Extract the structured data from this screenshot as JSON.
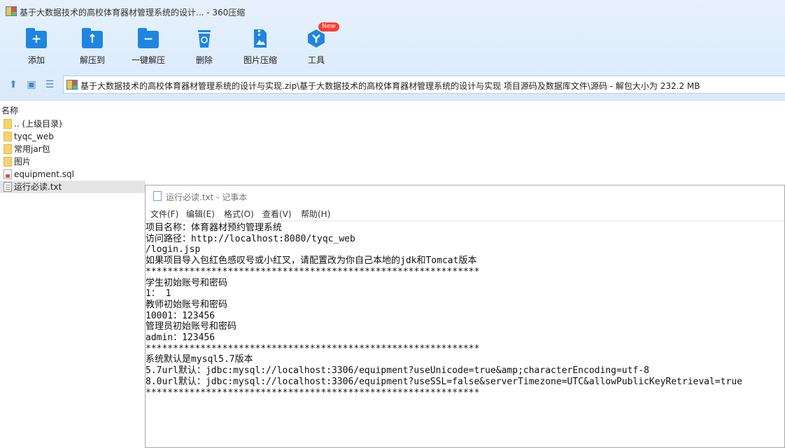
{
  "window": {
    "title": "基于大数据技术的高校体育器材管理系统的设计... - 360压缩"
  },
  "toolbar": {
    "items": [
      {
        "label": "添加",
        "icon": "add-icon"
      },
      {
        "label": "解压到",
        "icon": "extract-to-icon"
      },
      {
        "label": "一键解压",
        "icon": "one-click-extract-icon"
      },
      {
        "label": "删除",
        "icon": "delete-icon"
      },
      {
        "label": "图片压缩",
        "icon": "image-compress-icon"
      },
      {
        "label": "工具",
        "icon": "tools-icon",
        "badge": "New"
      }
    ]
  },
  "path": {
    "text": "基于大数据技术的高校体育器材管理系统的设计与实现.zip\\基于大数据技术的高校体育器材管理系统的设计与实现 项目源码及数据库文件\\源码 - 解包大小为 232.2 MB"
  },
  "filelist": {
    "header": "名称",
    "items": [
      {
        "name": ".. (上级目录)",
        "type": "folder"
      },
      {
        "name": "tyqc_web",
        "type": "folder"
      },
      {
        "name": "常用jar包",
        "type": "folder"
      },
      {
        "name": "图片",
        "type": "folder"
      },
      {
        "name": "equipment.sql",
        "type": "sql"
      },
      {
        "name": "运行必读.txt",
        "type": "txt",
        "selected": true
      }
    ]
  },
  "notepad": {
    "title": "运行必读.txt - 记事本",
    "menu": [
      "文件(F)",
      "编辑(E)",
      "格式(O)",
      "查看(V)",
      "帮助(H)"
    ],
    "content": "项目名称：体育器材预约管理系统\n访问路径：http://localhost:8080/tyqc_web\n/login.jsp\n如果项目导入包红色感叹号或小红叉，请配置改为你自己本地的jdk和Tomcat版本\n*************************************************************\n学生初始账号和密码\n1： 1\n教师初始账号和密码\n10001：123456\n管理员初始账号和密码\nadmin：123456\n*************************************************************\n系统默认是mysql5.7版本\n5.7url默认：jdbc:mysql://localhost:3306/equipment?useUnicode=true&amp;characterEncoding=utf-8\n8.0url默认：jdbc:mysql://localhost:3306/equipment?useSSL=false&serverTimezone=UTC&allowPublicKeyRetrieval=true\n*************************************************************"
  },
  "colors": {
    "accent": "#1e86e0",
    "toolbar_bg": "#dcecfb",
    "badge": "#ff3b30"
  }
}
